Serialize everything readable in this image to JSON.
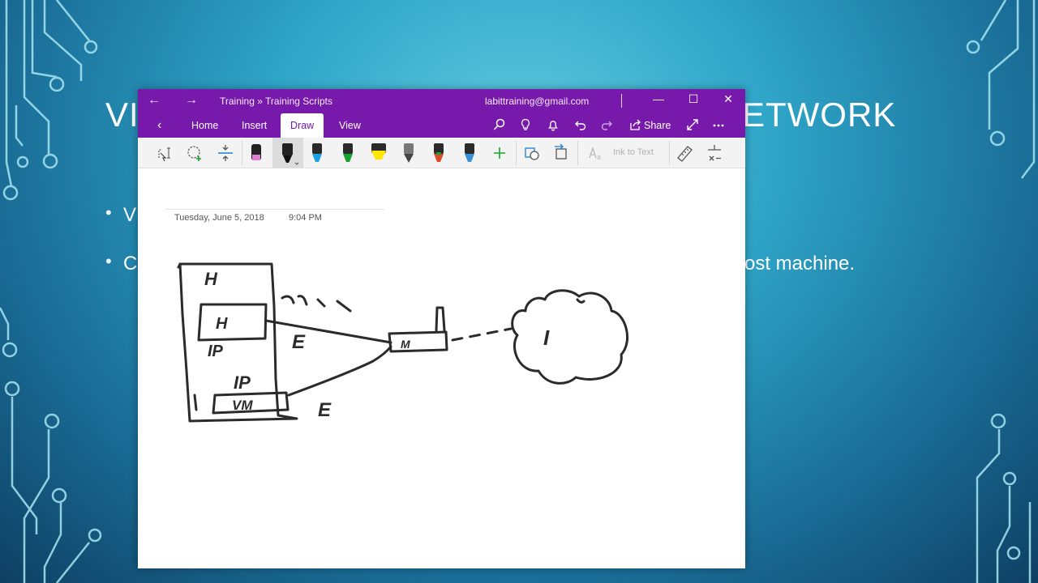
{
  "slide": {
    "title_left": "VI",
    "title_right": "ETWORK",
    "bullet_1": "V",
    "bullet_2": "C",
    "bullet_2_right": "ost machine.",
    "bullet_symbol": "•"
  },
  "window": {
    "breadcrumb": "Training » Training Scripts",
    "account": "labittraining@gmail.com",
    "back_glyph": "←",
    "forward_glyph": "→",
    "minimize_glyph": "—",
    "maximize_glyph": "☐",
    "close_glyph": "✕"
  },
  "ribbon": {
    "back_glyph": "‹",
    "tabs": [
      "Home",
      "Insert",
      "Draw",
      "View"
    ],
    "active_tab": "Draw",
    "share_label": "Share",
    "icons": [
      "search-icon",
      "lightbulb-icon",
      "bell-icon",
      "undo-icon",
      "redo-icon",
      "share-icon",
      "expand-icon",
      "more-icon"
    ]
  },
  "toolbar": {
    "ink_to_text_label": "Ink to Text",
    "pens": [
      {
        "name": "pen-pink",
        "color": "#e07fd2"
      },
      {
        "name": "pen-black-selected",
        "color": "#111111"
      },
      {
        "name": "pen-blue",
        "color": "#1ba1e2"
      },
      {
        "name": "pen-green",
        "color": "#17a330"
      },
      {
        "name": "highlighter-yellow",
        "color": "#ffe600"
      },
      {
        "name": "pen-pencil",
        "color": "#888888"
      },
      {
        "name": "pen-multi",
        "color": "#e04a2a"
      },
      {
        "name": "pen-galaxy",
        "color": "#3a8fd6"
      }
    ]
  },
  "page": {
    "date": "Tuesday, June 5, 2018",
    "time": "9:04 PM"
  },
  "drawing_labels": {
    "host_top": "H",
    "inner_box": "H",
    "ip_1": "IP",
    "ip_2": "IP",
    "vm_box": "VM",
    "e_1": "E",
    "e_2": "E",
    "modem": "M",
    "internet": "I"
  },
  "colors": {
    "onenote_purple": "#7719aa",
    "slide_accent": "#2ea4c7"
  }
}
